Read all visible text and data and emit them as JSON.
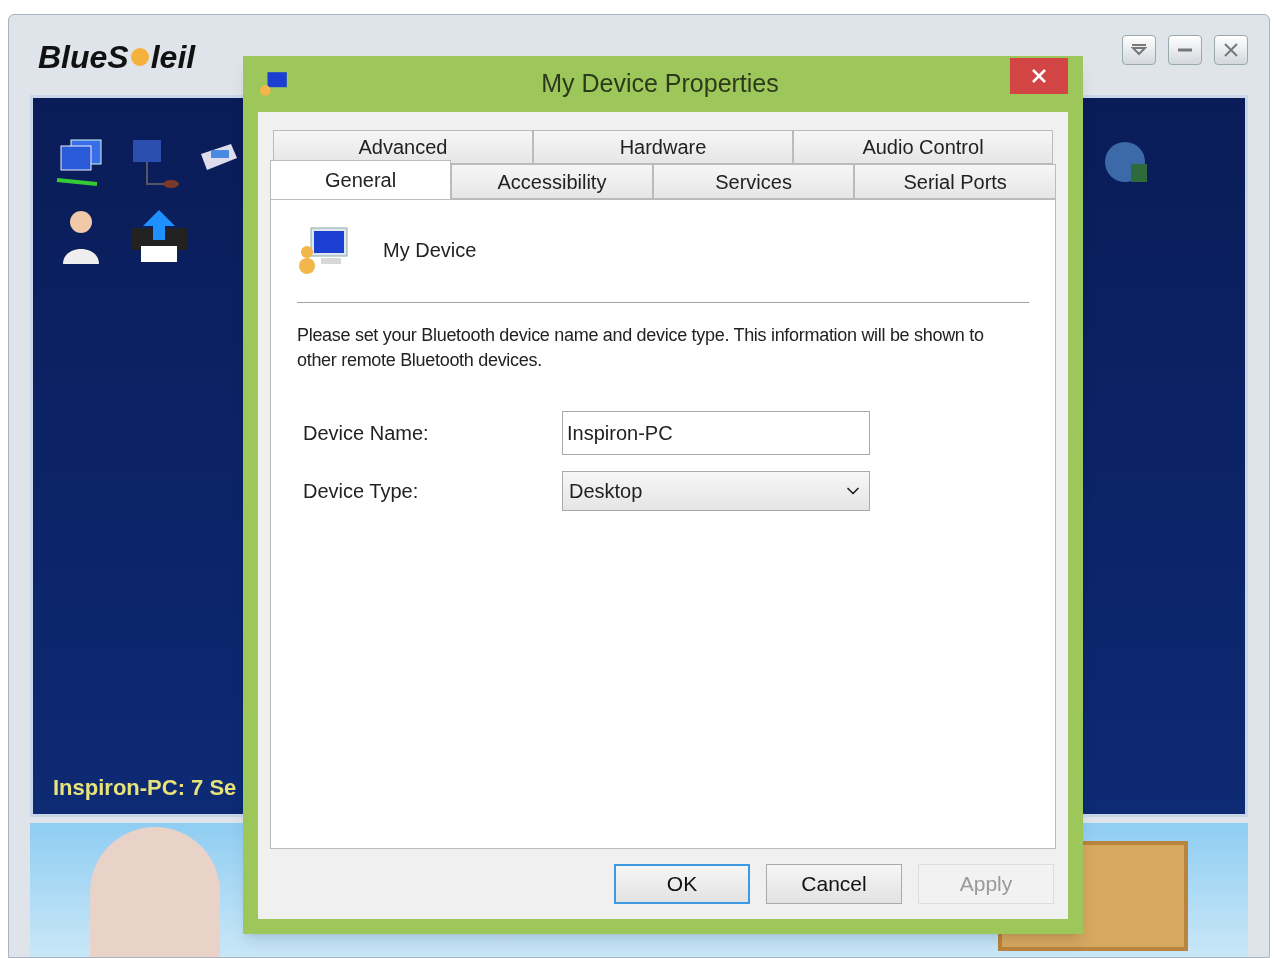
{
  "app": {
    "logo_before": "BlueS",
    "logo_after": "leil",
    "status": "Inspiron-PC: 7 Se"
  },
  "dialog": {
    "title": "My Device Properties",
    "tab_rows": [
      [
        {
          "label": "Advanced",
          "selected": false
        },
        {
          "label": "Hardware",
          "selected": false
        },
        {
          "label": "Audio Control",
          "selected": false
        }
      ],
      [
        {
          "label": "General",
          "selected": true
        },
        {
          "label": "Accessibility",
          "selected": false
        },
        {
          "label": "Services",
          "selected": false
        },
        {
          "label": "Serial Ports",
          "selected": false
        }
      ]
    ],
    "device_heading": "My Device",
    "description": "Please set your Bluetooth device name and device type. This information will be shown to other remote Bluetooth devices.",
    "fields": [
      {
        "kind": "text",
        "label": "Device Name:",
        "value": "Inspiron-PC"
      },
      {
        "kind": "select",
        "label": "Device Type:",
        "value": "Desktop"
      }
    ],
    "buttons": [
      {
        "label": "OK",
        "default": true,
        "disabled": false
      },
      {
        "label": "Cancel",
        "default": false,
        "disabled": false
      },
      {
        "label": "Apply",
        "default": false,
        "disabled": true
      }
    ]
  }
}
